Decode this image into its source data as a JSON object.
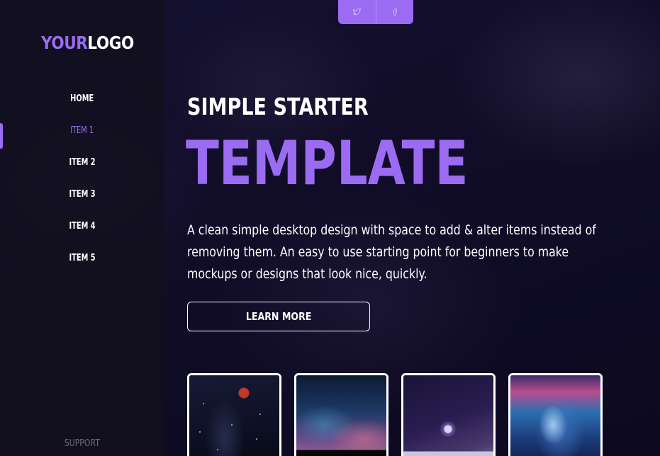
{
  "brand": {
    "logo_accent": "YOUR",
    "logo_rest": "LOGO",
    "accent_color": "#9b6bf2"
  },
  "social": {
    "items": [
      {
        "icon": "twitter-icon",
        "glyph": "🐦"
      },
      {
        "icon": "facebook-icon",
        "glyph": "f"
      }
    ]
  },
  "sidebar": {
    "items": [
      {
        "label": "HOME"
      },
      {
        "label": "ITEM 1"
      },
      {
        "label": "ITEM 2"
      },
      {
        "label": "ITEM 3"
      },
      {
        "label": "ITEM 4"
      },
      {
        "label": "ITEM 5"
      }
    ],
    "active_index": 1,
    "support_label": "SUPPORT"
  },
  "hero": {
    "eyebrow": "SIMPLE STARTER",
    "headline": "TEMPLATE",
    "description": "A clean simple desktop design with space to add & alter items instead of removing them. An easy to use starting point for beginners to make mockups or designs that look nice, quickly.",
    "cta_label": "LEARN MORE"
  },
  "cards": [
    {
      "image": "blood-moon-night-sky"
    },
    {
      "image": "starry-sky-rocks"
    },
    {
      "image": "snowy-night-light"
    },
    {
      "image": "chrome-robot-portrait"
    }
  ]
}
